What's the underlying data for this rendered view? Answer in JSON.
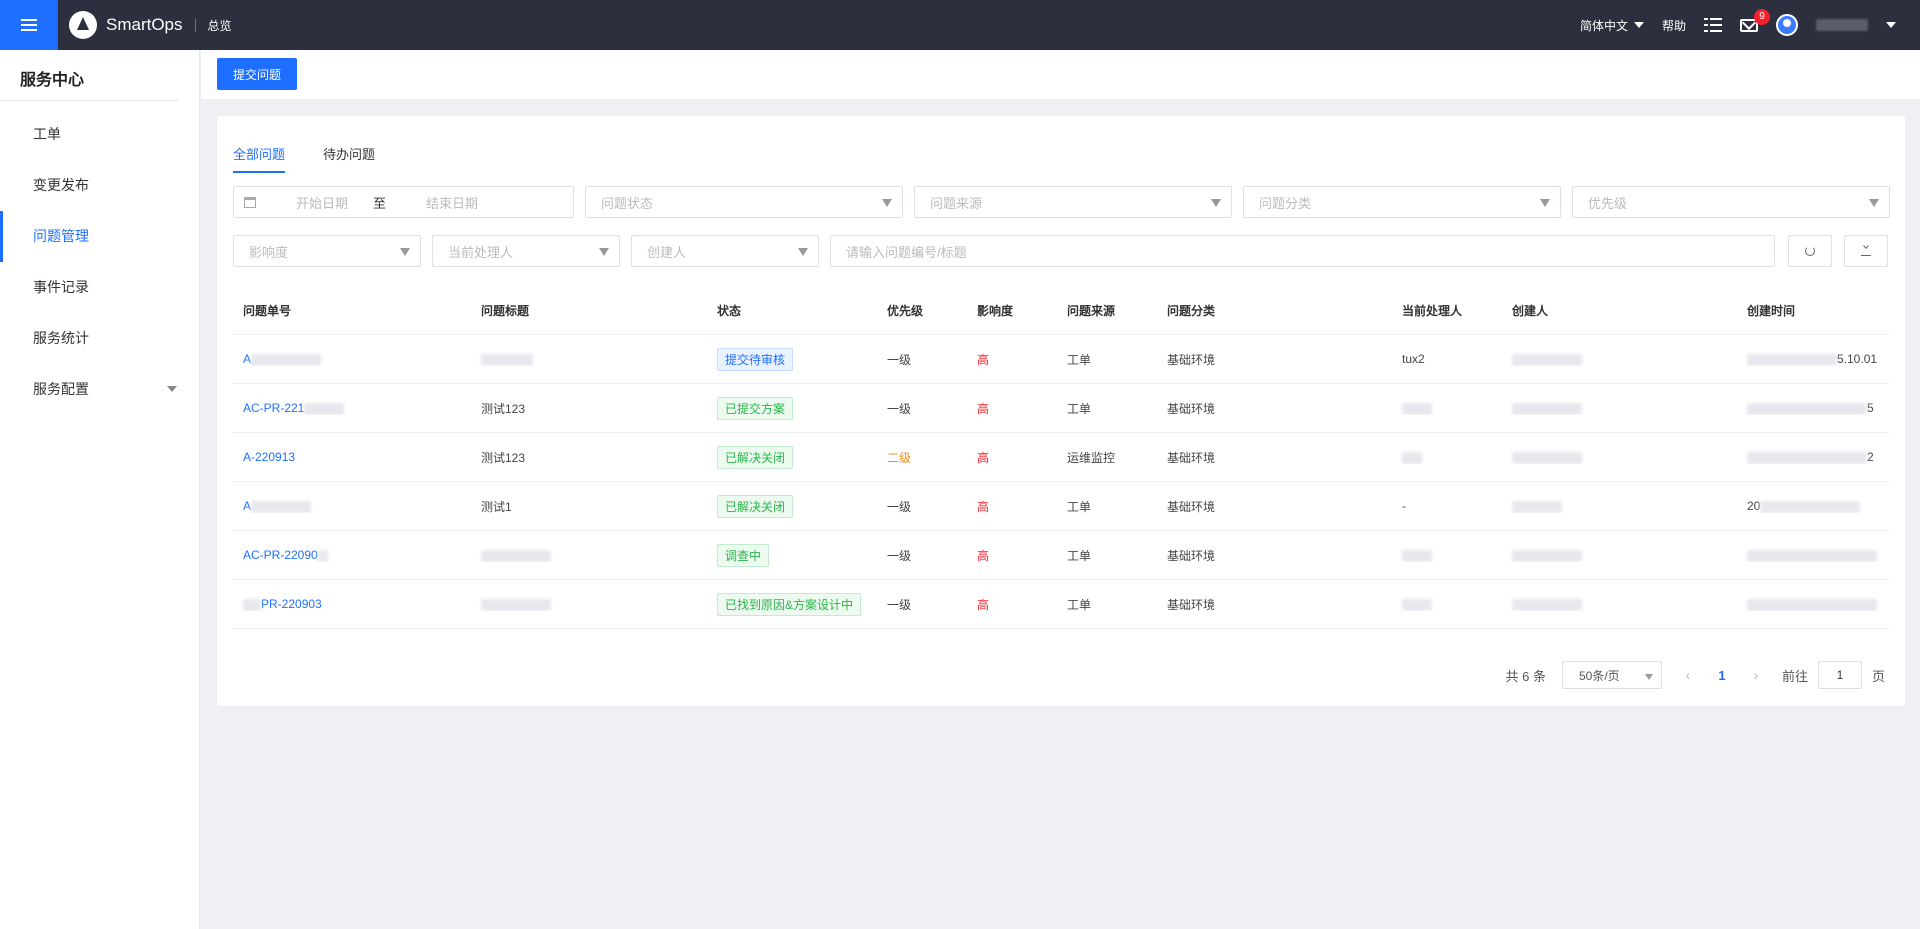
{
  "header": {
    "app_name": "SmartOps",
    "overview": "总览",
    "language": "简体中文",
    "help": "帮助",
    "mail_badge": "9"
  },
  "sidebar": {
    "title": "服务中心",
    "items": [
      {
        "label": "工单"
      },
      {
        "label": "变更发布"
      },
      {
        "label": "问题管理"
      },
      {
        "label": "事件记录"
      },
      {
        "label": "服务统计"
      },
      {
        "label": "服务配置"
      }
    ]
  },
  "toolbar": {
    "submit_label": "提交问题"
  },
  "tabs": [
    {
      "label": "全部问题"
    },
    {
      "label": "待办问题"
    }
  ],
  "filters": {
    "start_date": "开始日期",
    "date_separator": "至",
    "end_date": "结束日期",
    "status": "问题状态",
    "source": "问题来源",
    "category": "问题分类",
    "priority": "优先级",
    "impact": "影响度",
    "handler": "当前处理人",
    "creator": "创建人",
    "search_placeholder": "请输入问题编号/标题"
  },
  "table": {
    "columns": [
      "问题单号",
      "问题标题",
      "状态",
      "优先级",
      "影响度",
      "问题来源",
      "问题分类",
      "当前处理人",
      "创建人",
      "创建时间"
    ],
    "rows": [
      {
        "id": "A",
        "title": "",
        "status": "提交待审核",
        "priority": "一级",
        "impact": "高",
        "source": "工单",
        "category": "基础环境",
        "handler": "tux2",
        "creator": "",
        "created": "5.10.01"
      },
      {
        "id": "AC-PR-221",
        "title": "测试123",
        "status": "已提交方案",
        "priority": "一级",
        "impact": "高",
        "source": "工单",
        "category": "基础环境",
        "handler": "",
        "creator": "",
        "created": "5"
      },
      {
        "id": "A-220913",
        "title": "测试123",
        "status": "已解决关闭",
        "priority": "二级",
        "impact": "高",
        "source": "运维监控",
        "category": "基础环境",
        "handler": "",
        "creator": "",
        "created": "2"
      },
      {
        "id": "A",
        "title": "测试1",
        "status": "已解决关闭",
        "priority": "一级",
        "impact": "高",
        "source": "工单",
        "category": "基础环境",
        "handler": "-",
        "creator": "",
        "created": "20"
      },
      {
        "id": "AC-PR-22090",
        "title": "",
        "status": "调查中",
        "priority": "一级",
        "impact": "高",
        "source": "工单",
        "category": "基础环境",
        "handler": "",
        "creator": "",
        "created": ""
      },
      {
        "id": "PR-220903",
        "title": "",
        "status": "已找到原因&方案设计中",
        "priority": "一级",
        "impact": "高",
        "source": "工单",
        "category": "基础环境",
        "handler": "",
        "creator": "",
        "created": ""
      }
    ]
  },
  "pagination": {
    "total": "共 6 条",
    "page_size": "50条/页",
    "current_page": "1",
    "goto_label": "前往",
    "goto_value": "1",
    "page_suffix": "页"
  }
}
